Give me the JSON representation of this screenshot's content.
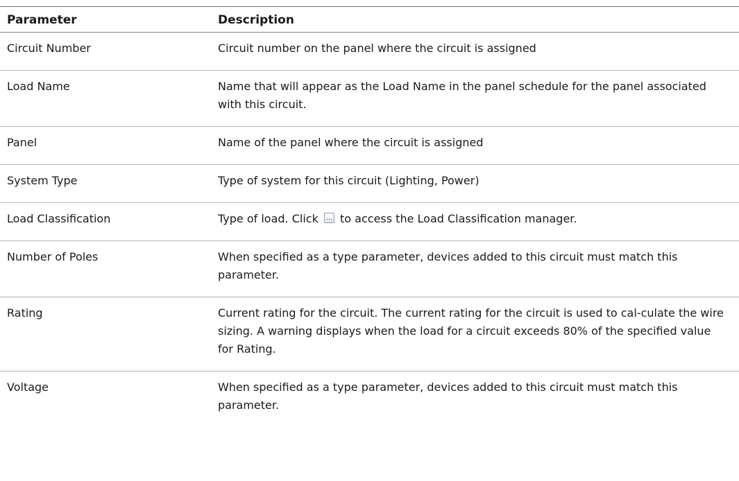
{
  "table": {
    "headers": {
      "parameter": "Parameter",
      "description": "Description"
    },
    "rows": [
      {
        "parameter": "Circuit Number",
        "description": "Circuit number on the panel where the circuit is assigned"
      },
      {
        "parameter": "Load Name",
        "description": "Name that will appear as the Load Name in the panel schedule for the panel associated with this circuit."
      },
      {
        "parameter": "Panel",
        "description": "Name of the panel where the circuit is assigned"
      },
      {
        "parameter": "System Type",
        "description": "Type of system for this circuit (Lighting, Power)"
      },
      {
        "parameter": "Load Classification",
        "description_before": "Type of load. Click",
        "description_after": "to access the Load Classification manager.",
        "button_icon": "ellipsis-browse-icon"
      },
      {
        "parameter": "Number of Poles",
        "description": "When specified as a type parameter, devices added to this circuit must match this parameter."
      },
      {
        "parameter": "Rating",
        "description": "Current rating for the circuit. The current rating for the circuit is used to cal-culate the wire sizing. A warning displays when the load for a circuit exceeds 80% of the specified value for Rating."
      },
      {
        "parameter": "Voltage",
        "description": "When specified as a type parameter, devices added to this circuit must match this parameter."
      }
    ]
  },
  "colors": {
    "rule": "#b3b3b3",
    "text": "#1a1a1a"
  }
}
